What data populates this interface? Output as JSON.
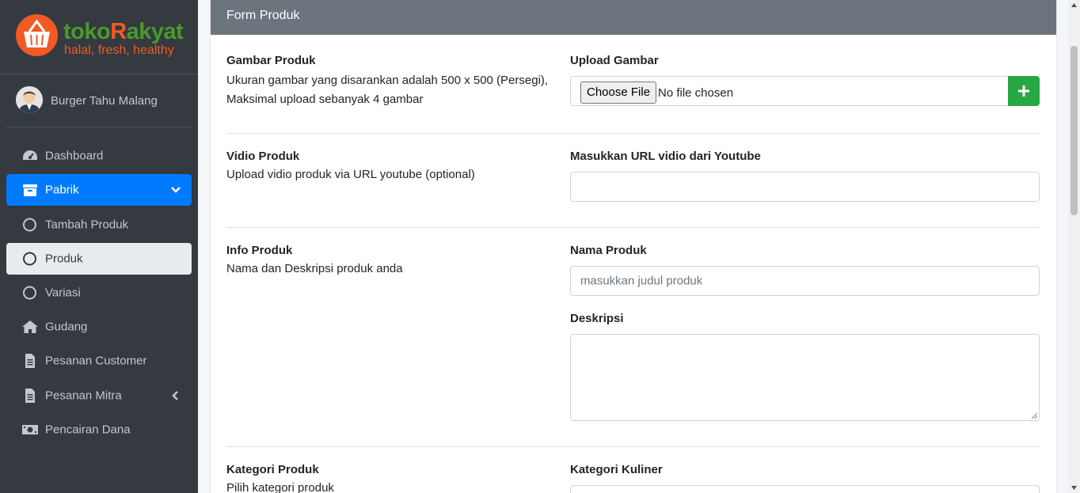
{
  "brand": {
    "name_part1": "toko",
    "name_part2": "R",
    "name_part3": "akyat",
    "tagline": "halal, fresh, healthy"
  },
  "user": {
    "name": "Burger Tahu Malang"
  },
  "sidebar": {
    "items": [
      {
        "label": "Dashboard",
        "icon": "dashboard-icon"
      },
      {
        "label": "Pabrik",
        "icon": "archive-icon",
        "state": "active-expanded"
      },
      {
        "label": "Tambah Produk",
        "icon": "circle-icon"
      },
      {
        "label": "Produk",
        "icon": "circle-icon",
        "state": "selected"
      },
      {
        "label": "Variasi",
        "icon": "circle-icon"
      },
      {
        "label": "Gudang",
        "icon": "home-icon"
      },
      {
        "label": "Pesanan Customer",
        "icon": "file-icon"
      },
      {
        "label": "Pesanan Mitra",
        "icon": "file-icon",
        "state": "collapsed"
      },
      {
        "label": "Pencairan Dana",
        "icon": "money-icon"
      }
    ]
  },
  "form": {
    "header": "Form Produk",
    "gambar": {
      "title": "Gambar Produk",
      "desc": "Ukuran gambar yang disarankan adalah 500 x 500 (Persegi), Maksimal upload sebanyak 4 gambar",
      "field_label": "Upload Gambar",
      "choose_label": "Choose File",
      "no_file": "No file chosen"
    },
    "vidio": {
      "title": "Vidio Produk",
      "desc": "Upload vidio produk via URL youtube (optional)",
      "field_label": "Masukkan URL vidio dari Youtube",
      "value": ""
    },
    "info": {
      "title": "Info Produk",
      "desc": "Nama dan Deskripsi produk anda",
      "name_label": "Nama Produk",
      "name_placeholder": "masukkan judul produk",
      "desc_label": "Deskripsi"
    },
    "kategori": {
      "title": "Kategori Produk",
      "desc": "Pilih kategori produk",
      "field_label": "Kategori Kuliner"
    }
  },
  "colors": {
    "sidebar": "#343a40",
    "active": "#007bff",
    "header": "#6c757d",
    "add_button": "#28a745",
    "brand_green": "#4a9a2a",
    "brand_orange": "#f15a24"
  }
}
